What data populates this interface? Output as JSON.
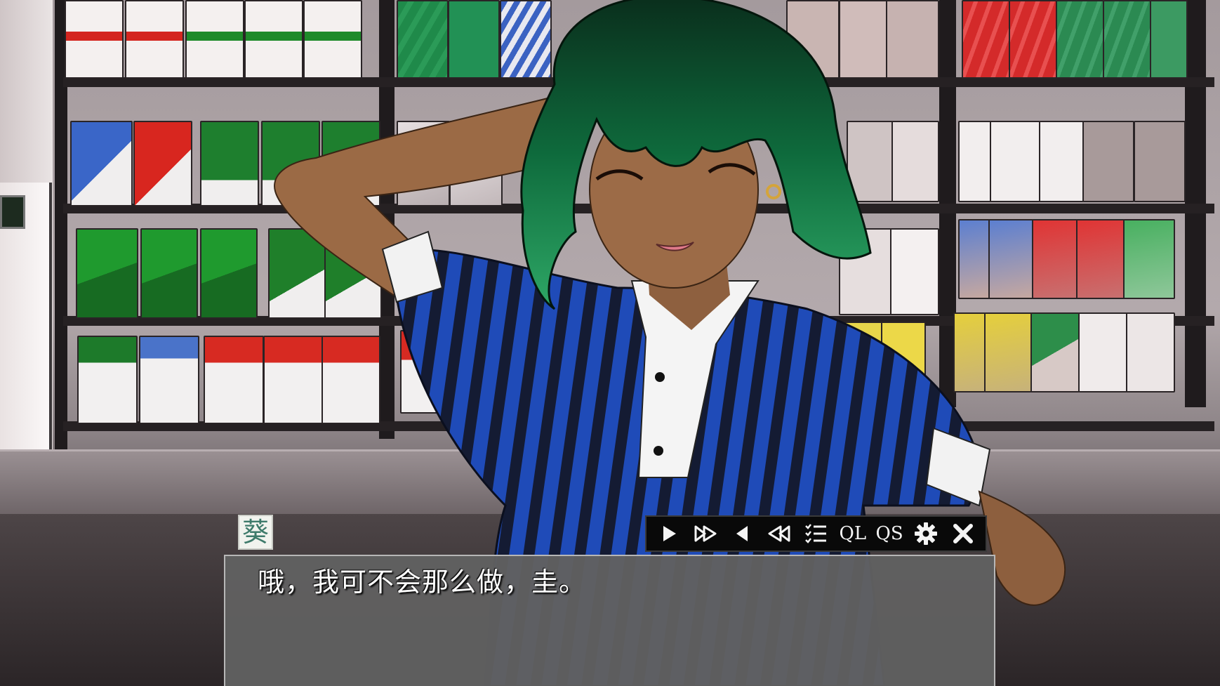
{
  "speaker": {
    "name": "葵"
  },
  "dialogue": {
    "text": "哦，我可不会那么做，圭。"
  },
  "quick_menu": {
    "play_icon": "play-icon",
    "skip_icon": "fast-forward-icon",
    "back_icon": "back-icon",
    "rewind_icon": "rewind-icon",
    "history_icon": "history-list-icon",
    "quick_load_label": "QL",
    "quick_save_label": "QS",
    "settings_icon": "gear-icon",
    "close_icon": "close-icon"
  },
  "colors": {
    "dialogue_bg": "#606060",
    "menu_bg": "#090909",
    "hair": "#0e6a3c",
    "shirt_stripe_blue": "#1f4bb8",
    "shirt_stripe_dark": "#141b33"
  }
}
